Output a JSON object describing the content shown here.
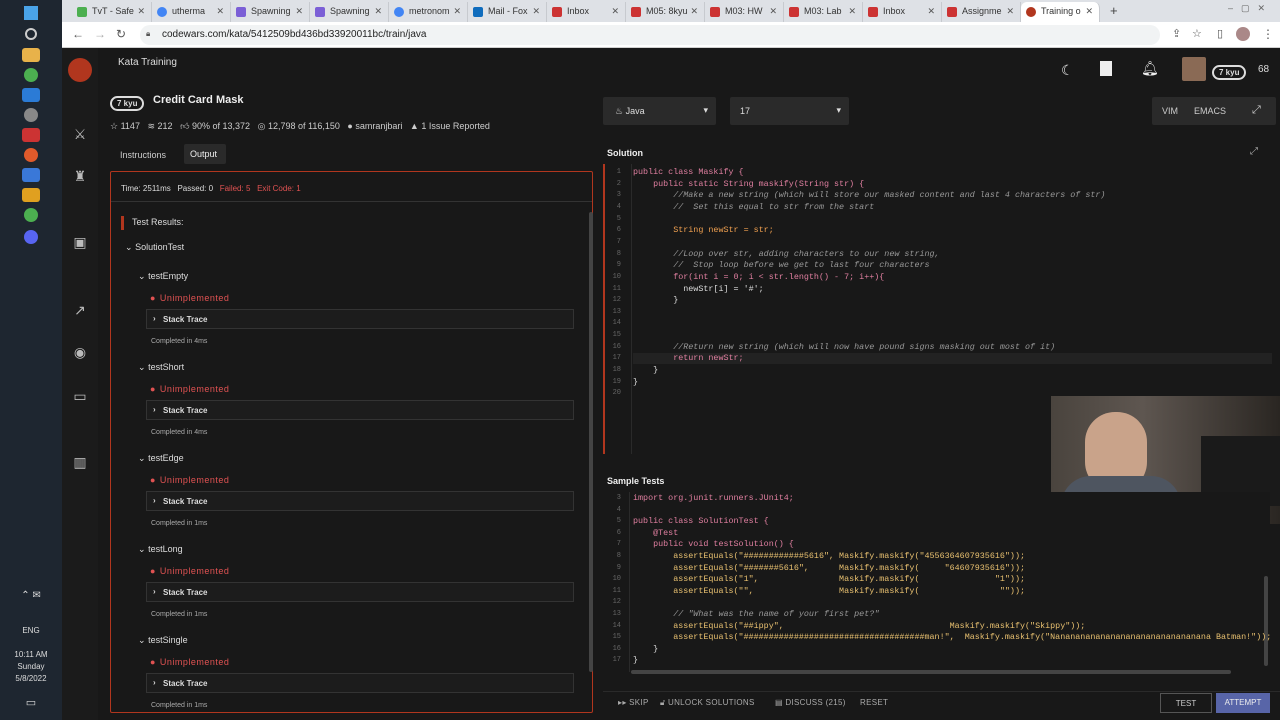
{
  "browser": {
    "tabs": [
      "TvT - Safe",
      "utherma",
      "Spawning",
      "Spawning",
      "metronom",
      "Mail - Fox",
      "Inbox",
      "M05: 8kyu",
      "M03: HW",
      "M03: Lab",
      "Inbox",
      "Assignme",
      "Training o"
    ],
    "url": "codewars.com/kata/5412509bd436bd33920011bc/train/java"
  },
  "taskbar": {
    "lang": "ENG",
    "time": "10:11 AM",
    "day": "Sunday",
    "date": "5/8/2022"
  },
  "header": {
    "section": "Kata Training",
    "user_kyu": "7 kyu",
    "honor": "68"
  },
  "kata": {
    "kyu": "7 kyu",
    "title": "Credit Card Mask",
    "stars": "1147",
    "collections": "212",
    "satisfaction": "90% of 13,372",
    "completed": "12,798 of 116,150",
    "author": "samranjbari",
    "issues": "1 Issue Reported"
  },
  "tabs": {
    "instructions": "Instructions",
    "output": "Output"
  },
  "output": {
    "time": "Time: 2511ms",
    "passed": "Passed: 0",
    "failed": "Failed: 5",
    "exit": "Exit Code: 1",
    "results_label": "Test Results:",
    "suite": "SolutionTest",
    "tests": [
      {
        "name": "testEmpty",
        "status": "Unimplemented",
        "trace": "Stack Trace",
        "completed": "Completed in 4ms"
      },
      {
        "name": "testShort",
        "status": "Unimplemented",
        "trace": "Stack Trace",
        "completed": "Completed in 4ms"
      },
      {
        "name": "testEdge",
        "status": "Unimplemented",
        "trace": "Stack Trace",
        "completed": "Completed in 1ms"
      },
      {
        "name": "testLong",
        "status": "Unimplemented",
        "trace": "Stack Trace",
        "completed": "Completed in 1ms"
      },
      {
        "name": "testSingle",
        "status": "Unimplemented",
        "trace": "Stack Trace",
        "completed": "Completed in 1ms"
      }
    ]
  },
  "editor": {
    "language": "Java",
    "version": "17",
    "vim": "VIM",
    "emacs": "EMACS",
    "solution_label": "Solution",
    "tests_label": "Sample Tests"
  },
  "solution_code": [
    "public class Maskify {",
    "    public static String maskify(String str) {",
    "        //Make a new string (which will store our masked content and last 4 characters of str)",
    "        //  Set this equal to str from the start",
    "",
    "        String newStr = str;",
    "",
    "        //Loop over str, adding characters to our new string,",
    "        //  Stop loop before we get to last four characters",
    "        for(int i = 0; i < str.length() - 7; i++){",
    "          newStr[i] = '#';",
    "        }",
    "",
    "",
    "",
    "        //Return new string (which will now have pound signs masking out most of it)",
    "        return newStr;",
    "    }",
    "}",
    ""
  ],
  "test_code": [
    "import org.junit.runners.JUnit4;",
    "",
    "public class SolutionTest {",
    "    @Test",
    "    public void testSolution() {",
    "        assertEquals(\"############5616\", Maskify.maskify(\"4556364607935616\"));",
    "        assertEquals(\"#######5616\",      Maskify.maskify(     \"64607935616\"));",
    "        assertEquals(\"1\",                Maskify.maskify(               \"1\"));",
    "        assertEquals(\"\",                 Maskify.maskify(                \"\"));",
    "",
    "        // \"What was the name of your first pet?\"",
    "        assertEquals(\"##ippy\",                                 Maskify.maskify(\"Skippy\"));",
    "        assertEquals(\"####################################man!\",  Maskify.maskify(\"Nananananananananananananananana Batman!\"));",
    "    }",
    "}"
  ],
  "test_line_numbers": [
    "3",
    "4",
    "5",
    "6",
    "7",
    "8",
    "9",
    "10",
    "11",
    "12",
    "13",
    "14",
    "15",
    "16",
    "17"
  ],
  "footer": {
    "skip": "SKIP",
    "unlock": "UNLOCK SOLUTIONS",
    "discuss": "DISCUSS (215)",
    "reset": "RESET",
    "test": "TEST",
    "attempt": "ATTEMPT"
  }
}
